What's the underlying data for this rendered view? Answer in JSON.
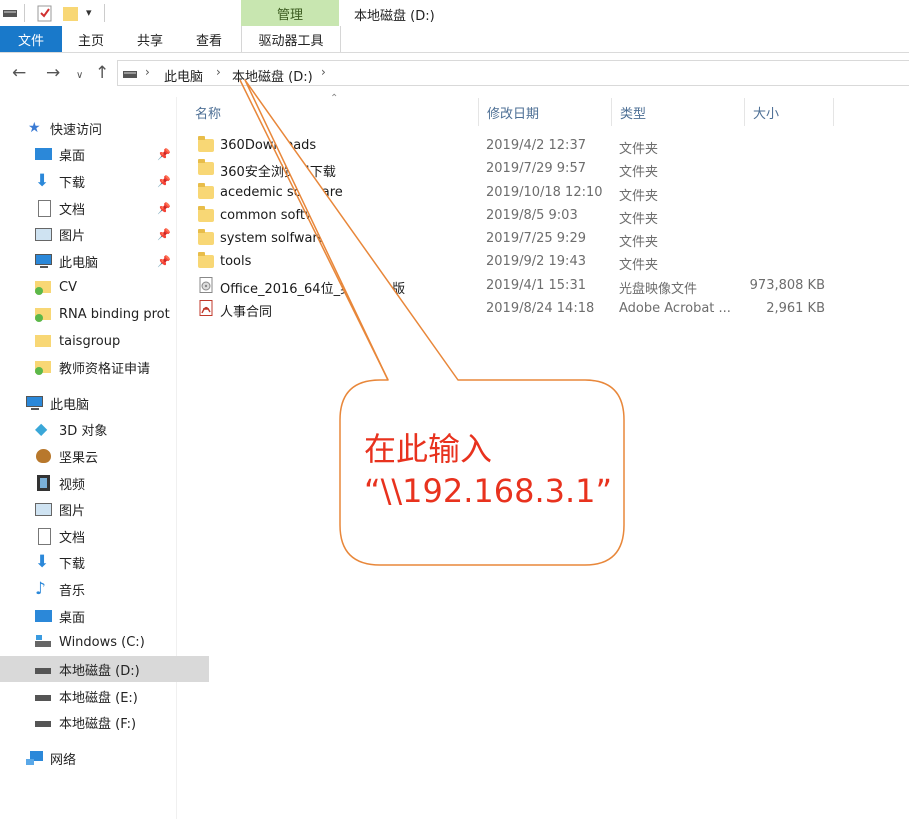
{
  "window": {
    "title": "本地磁盘 (D:)",
    "contextual_tab_group": "管理"
  },
  "ribbon": {
    "tabs": [
      "文件",
      "主页",
      "共享",
      "查看",
      "驱动器工具"
    ]
  },
  "address": {
    "crumbs": [
      "此电脑",
      "本地磁盘 (D:)"
    ]
  },
  "sidebar": {
    "quick_access": "快速访问",
    "quick_items": [
      "桌面",
      "下载",
      "文档",
      "图片",
      "此电脑",
      "CV",
      "RNA binding prot",
      "taisgroup",
      "教师资格证申请"
    ],
    "this_pc": "此电脑",
    "pc_items": [
      "3D 对象",
      "坚果云",
      "视频",
      "图片",
      "文档",
      "下载",
      "音乐",
      "桌面",
      "Windows (C:)",
      "本地磁盘 (D:)",
      "本地磁盘 (E:)",
      "本地磁盘 (F:)"
    ],
    "network": "网络"
  },
  "columns": {
    "name": "名称",
    "date": "修改日期",
    "type": "类型",
    "size": "大小"
  },
  "files": [
    {
      "name": "360Downloads",
      "date": "2019/4/2 12:37",
      "type": "文件夹",
      "size": "",
      "icon": "folder-icon"
    },
    {
      "name": "360安全浏览器下载",
      "date": "2019/7/29 9:57",
      "type": "文件夹",
      "size": "",
      "icon": "folder-icon"
    },
    {
      "name": "acedemic software",
      "date": "2019/10/18 12:10",
      "type": "文件夹",
      "size": "",
      "icon": "folder-icon"
    },
    {
      "name": "common software",
      "date": "2019/8/5 9:03",
      "type": "文件夹",
      "size": "",
      "icon": "folder-icon"
    },
    {
      "name": "system solfware",
      "date": "2019/7/25 9:29",
      "type": "文件夹",
      "size": "",
      "icon": "folder-icon"
    },
    {
      "name": "tools",
      "date": "2019/9/2 19:43",
      "type": "文件夹",
      "size": "",
      "icon": "folder-icon"
    },
    {
      "name": "Office_2016_64位_英文专业版",
      "date": "2019/4/1 15:31",
      "type": "光盘映像文件",
      "size": "973,808 KB",
      "icon": "disc-image-icon"
    },
    {
      "name": "人事合同",
      "date": "2019/8/24 14:18",
      "type": "Adobe Acrobat ...",
      "size": "2,961 KB",
      "icon": "pdf-icon"
    }
  ],
  "callout": {
    "line1": "在此输入",
    "line2": "“\\\\192.168.3.1”",
    "color": "#e8321e",
    "border_color": "#e8873a"
  },
  "colors": {
    "file_tab": "#1979ca",
    "manage_tab": "#c8e6b0",
    "header_text": "#4d6f95",
    "selected_row": "#d9d9d9"
  }
}
